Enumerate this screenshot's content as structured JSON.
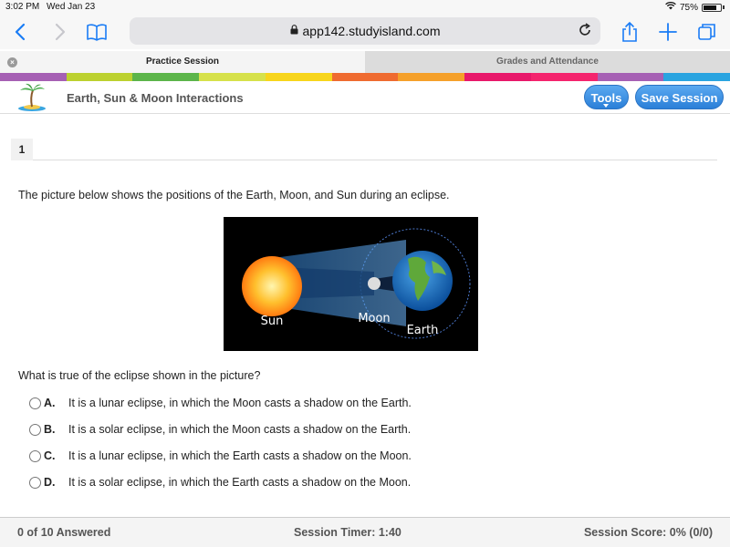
{
  "status_bar": {
    "time": "3:02 PM",
    "date": "Wed Jan 23",
    "battery": "75%",
    "icons": [
      "wifi-icon",
      "battery-icon"
    ]
  },
  "browser": {
    "url": "app142.studyisland.com",
    "icons": [
      "back-icon",
      "forward-icon",
      "bookmarks-icon",
      "lock-icon",
      "reload-icon",
      "share-icon",
      "new-tab-icon",
      "tabs-icon"
    ],
    "tabs": [
      {
        "label": "Practice Session",
        "active": true
      },
      {
        "label": "Grades and Attendance",
        "active": false
      }
    ]
  },
  "rainbow_colors": [
    "#a660b4",
    "#bcd12f",
    "#5cb54a",
    "#d6e14a",
    "#f7d51c",
    "#ef6b30",
    "#f5a02a",
    "#e8186a",
    "#f4246d",
    "#a660b4",
    "#2aa4e0"
  ],
  "header": {
    "title": "Earth, Sun & Moon Interactions",
    "tools_label": "Tools",
    "save_label": "Save Session",
    "accent": "#2b7fd8"
  },
  "question": {
    "number": "1",
    "intro": "The picture below shows the positions of the Earth, Moon, and Sun during an eclipse.",
    "figure_labels": {
      "sun": "Sun",
      "moon": "Moon",
      "earth": "Earth"
    },
    "prompt": "What is true of the eclipse shown in the picture?",
    "choices": [
      {
        "letter": "A.",
        "text": "It is a lunar eclipse, in which the Moon casts a shadow on the Earth."
      },
      {
        "letter": "B.",
        "text": "It is a solar eclipse, in which the Moon casts a shadow on the Earth."
      },
      {
        "letter": "C.",
        "text": "It is a lunar eclipse, in which the Earth casts a shadow on the Moon."
      },
      {
        "letter": "D.",
        "text": "It is a solar eclipse, in which the Earth casts a shadow on the Moon."
      }
    ]
  },
  "footer": {
    "answered": "0 of 10 Answered",
    "timer": "Session Timer: 1:40",
    "score": "Session Score: 0% (0/0)"
  }
}
